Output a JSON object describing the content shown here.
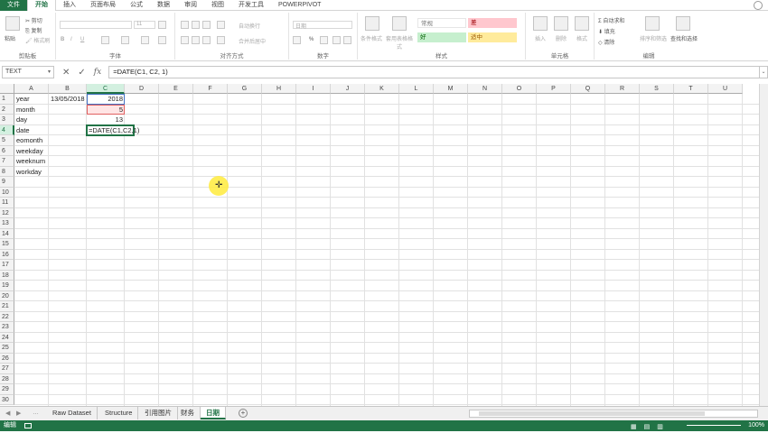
{
  "menu": {
    "tabs": [
      "文件",
      "开始",
      "插入",
      "页面布局",
      "公式",
      "数据",
      "审阅",
      "视图",
      "开发工具",
      "POWERPIVOT"
    ],
    "active": "开始"
  },
  "ribbon": {
    "clipboard": {
      "paste": "粘贴",
      "cut": "剪切",
      "copy": "复制",
      "format_painter": "格式刷",
      "label": "剪贴板"
    },
    "font": {
      "size": "11",
      "bold": "B",
      "italic": "I",
      "underline": "U",
      "label": "字体"
    },
    "alignment": {
      "wrap": "自动换行",
      "merge": "合并后居中",
      "label": "对齐方式"
    },
    "number": {
      "format": "日期",
      "percent": "%",
      "label": "数字"
    },
    "styles": {
      "cond_format": "条件格式",
      "table_format": "套用表格格式",
      "normal": "常规",
      "bad": "差",
      "good": "好",
      "neutral": "适中",
      "label": "样式"
    },
    "cells": {
      "insert": "插入",
      "delete": "删除",
      "format": "格式",
      "label": "单元格"
    },
    "editing": {
      "autosum": "自动求和",
      "fill": "填充",
      "clear": "清除",
      "sort": "排序和筛选",
      "find": "查找和选择",
      "label": "编辑"
    }
  },
  "formula_bar": {
    "name_box": "TEXT",
    "formula": "=DATE(C1, C2, 1)"
  },
  "columns": [
    "A",
    "B",
    "C",
    "D",
    "E",
    "F",
    "G",
    "H",
    "I",
    "J",
    "K",
    "L",
    "M",
    "N",
    "O",
    "P",
    "Q",
    "R",
    "S",
    "T",
    "U"
  ],
  "rows": [
    "1",
    "2",
    "3",
    "4",
    "5",
    "6",
    "7",
    "8",
    "9",
    "10",
    "11",
    "12",
    "13",
    "14",
    "15",
    "16",
    "17",
    "18",
    "19",
    "20",
    "21",
    "22",
    "23",
    "24",
    "25",
    "26",
    "27",
    "28",
    "29",
    "30"
  ],
  "cells": {
    "a1": "year",
    "a2": "month",
    "a3": "day",
    "a4": "date",
    "a5": "eomonth",
    "a6": "weekday",
    "a7": "weeknum",
    "a8": "workday",
    "b1": "13/05/2018",
    "c1": "2018",
    "c2": "5",
    "c3": "13",
    "c4_edit": "=DATE(C1,C2,1)"
  },
  "sheets": {
    "tabs": [
      "Raw Dataset",
      "Structure",
      "引用图片",
      "财务",
      "日期"
    ],
    "active": "日期"
  },
  "status": {
    "mode": "编辑",
    "zoom": "100%"
  },
  "colors": {
    "accent": "#217346",
    "ref_blue": "#4472c4",
    "ref_red": "#e06060"
  }
}
